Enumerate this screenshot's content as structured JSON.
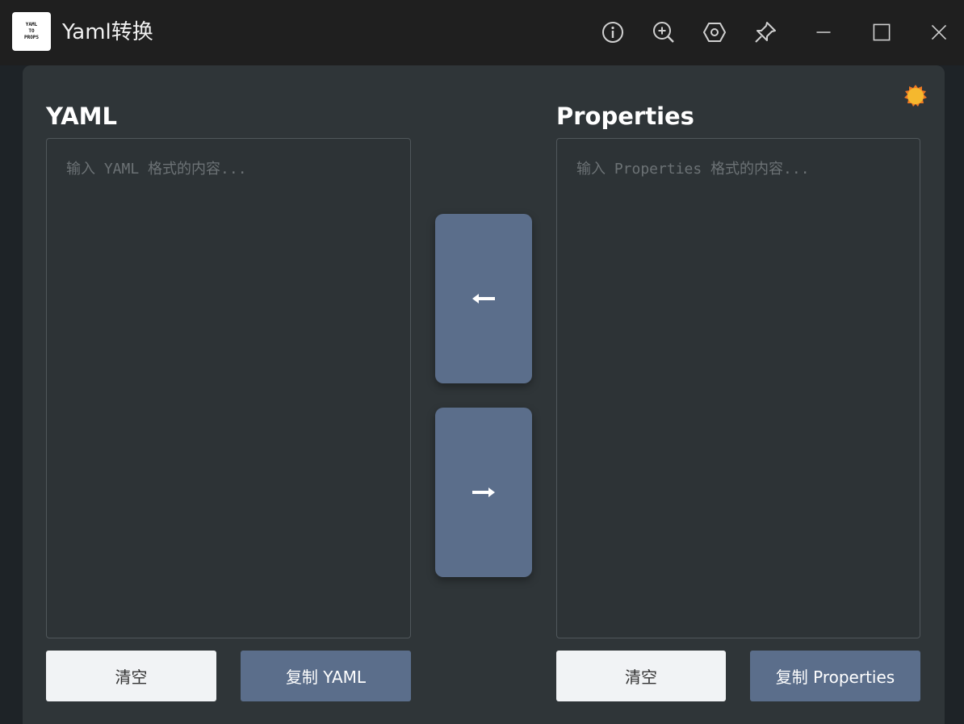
{
  "window": {
    "title": "Yaml转换",
    "logo_lines": [
      "YAML",
      "TO",
      "PROPS"
    ]
  },
  "toolbar": {
    "icons": [
      "info-icon",
      "zoom-in-icon",
      "settings-icon",
      "pin-icon"
    ],
    "window_controls": [
      "minimize-icon",
      "maximize-icon",
      "close-icon"
    ]
  },
  "theme": {
    "icon": "sun-icon",
    "accent": "#f5b82e"
  },
  "yaml_panel": {
    "title": "YAML",
    "placeholder": "输入 YAML 格式的内容...",
    "value": "",
    "clear_label": "清空",
    "copy_label": "复制 YAML"
  },
  "props_panel": {
    "title": "Properties",
    "placeholder": "输入 Properties 格式的内容...",
    "value": "",
    "clear_label": "清空",
    "copy_label": "复制 Properties"
  },
  "convert": {
    "to_yaml_icon": "arrow-left-icon",
    "to_props_icon": "arrow-right-icon"
  },
  "colors": {
    "button_accent": "#5b6e8b",
    "titlebar": "#1f1f1f",
    "card": "#2f3538"
  }
}
